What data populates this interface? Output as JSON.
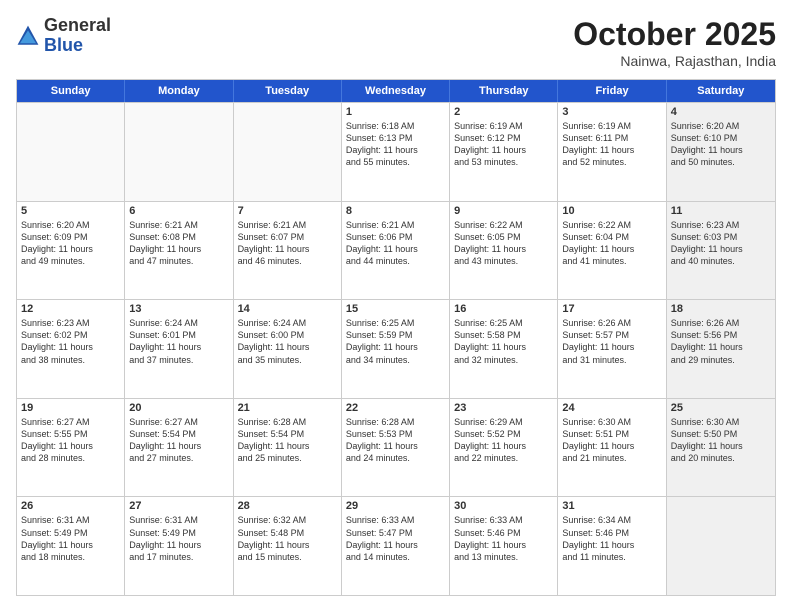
{
  "header": {
    "logo_general": "General",
    "logo_blue": "Blue",
    "month": "October 2025",
    "location": "Nainwa, Rajasthan, India"
  },
  "days_of_week": [
    "Sunday",
    "Monday",
    "Tuesday",
    "Wednesday",
    "Thursday",
    "Friday",
    "Saturday"
  ],
  "rows": [
    [
      {
        "day": "",
        "sunrise": "",
        "sunset": "",
        "daylight": "",
        "shaded": false,
        "empty": true
      },
      {
        "day": "",
        "sunrise": "",
        "sunset": "",
        "daylight": "",
        "shaded": false,
        "empty": true
      },
      {
        "day": "",
        "sunrise": "",
        "sunset": "",
        "daylight": "",
        "shaded": false,
        "empty": true
      },
      {
        "day": "1",
        "sunrise": "Sunrise: 6:18 AM",
        "sunset": "Sunset: 6:13 PM",
        "daylight": "Daylight: 11 hours and 55 minutes.",
        "shaded": false,
        "empty": false
      },
      {
        "day": "2",
        "sunrise": "Sunrise: 6:19 AM",
        "sunset": "Sunset: 6:12 PM",
        "daylight": "Daylight: 11 hours and 53 minutes.",
        "shaded": false,
        "empty": false
      },
      {
        "day": "3",
        "sunrise": "Sunrise: 6:19 AM",
        "sunset": "Sunset: 6:11 PM",
        "daylight": "Daylight: 11 hours and 52 minutes.",
        "shaded": false,
        "empty": false
      },
      {
        "day": "4",
        "sunrise": "Sunrise: 6:20 AM",
        "sunset": "Sunset: 6:10 PM",
        "daylight": "Daylight: 11 hours and 50 minutes.",
        "shaded": true,
        "empty": false
      }
    ],
    [
      {
        "day": "5",
        "sunrise": "Sunrise: 6:20 AM",
        "sunset": "Sunset: 6:09 PM",
        "daylight": "Daylight: 11 hours and 49 minutes.",
        "shaded": false,
        "empty": false
      },
      {
        "day": "6",
        "sunrise": "Sunrise: 6:21 AM",
        "sunset": "Sunset: 6:08 PM",
        "daylight": "Daylight: 11 hours and 47 minutes.",
        "shaded": false,
        "empty": false
      },
      {
        "day": "7",
        "sunrise": "Sunrise: 6:21 AM",
        "sunset": "Sunset: 6:07 PM",
        "daylight": "Daylight: 11 hours and 46 minutes.",
        "shaded": false,
        "empty": false
      },
      {
        "day": "8",
        "sunrise": "Sunrise: 6:21 AM",
        "sunset": "Sunset: 6:06 PM",
        "daylight": "Daylight: 11 hours and 44 minutes.",
        "shaded": false,
        "empty": false
      },
      {
        "day": "9",
        "sunrise": "Sunrise: 6:22 AM",
        "sunset": "Sunset: 6:05 PM",
        "daylight": "Daylight: 11 hours and 43 minutes.",
        "shaded": false,
        "empty": false
      },
      {
        "day": "10",
        "sunrise": "Sunrise: 6:22 AM",
        "sunset": "Sunset: 6:04 PM",
        "daylight": "Daylight: 11 hours and 41 minutes.",
        "shaded": false,
        "empty": false
      },
      {
        "day": "11",
        "sunrise": "Sunrise: 6:23 AM",
        "sunset": "Sunset: 6:03 PM",
        "daylight": "Daylight: 11 hours and 40 minutes.",
        "shaded": true,
        "empty": false
      }
    ],
    [
      {
        "day": "12",
        "sunrise": "Sunrise: 6:23 AM",
        "sunset": "Sunset: 6:02 PM",
        "daylight": "Daylight: 11 hours and 38 minutes.",
        "shaded": false,
        "empty": false
      },
      {
        "day": "13",
        "sunrise": "Sunrise: 6:24 AM",
        "sunset": "Sunset: 6:01 PM",
        "daylight": "Daylight: 11 hours and 37 minutes.",
        "shaded": false,
        "empty": false
      },
      {
        "day": "14",
        "sunrise": "Sunrise: 6:24 AM",
        "sunset": "Sunset: 6:00 PM",
        "daylight": "Daylight: 11 hours and 35 minutes.",
        "shaded": false,
        "empty": false
      },
      {
        "day": "15",
        "sunrise": "Sunrise: 6:25 AM",
        "sunset": "Sunset: 5:59 PM",
        "daylight": "Daylight: 11 hours and 34 minutes.",
        "shaded": false,
        "empty": false
      },
      {
        "day": "16",
        "sunrise": "Sunrise: 6:25 AM",
        "sunset": "Sunset: 5:58 PM",
        "daylight": "Daylight: 11 hours and 32 minutes.",
        "shaded": false,
        "empty": false
      },
      {
        "day": "17",
        "sunrise": "Sunrise: 6:26 AM",
        "sunset": "Sunset: 5:57 PM",
        "daylight": "Daylight: 11 hours and 31 minutes.",
        "shaded": false,
        "empty": false
      },
      {
        "day": "18",
        "sunrise": "Sunrise: 6:26 AM",
        "sunset": "Sunset: 5:56 PM",
        "daylight": "Daylight: 11 hours and 29 minutes.",
        "shaded": true,
        "empty": false
      }
    ],
    [
      {
        "day": "19",
        "sunrise": "Sunrise: 6:27 AM",
        "sunset": "Sunset: 5:55 PM",
        "daylight": "Daylight: 11 hours and 28 minutes.",
        "shaded": false,
        "empty": false
      },
      {
        "day": "20",
        "sunrise": "Sunrise: 6:27 AM",
        "sunset": "Sunset: 5:54 PM",
        "daylight": "Daylight: 11 hours and 27 minutes.",
        "shaded": false,
        "empty": false
      },
      {
        "day": "21",
        "sunrise": "Sunrise: 6:28 AM",
        "sunset": "Sunset: 5:54 PM",
        "daylight": "Daylight: 11 hours and 25 minutes.",
        "shaded": false,
        "empty": false
      },
      {
        "day": "22",
        "sunrise": "Sunrise: 6:28 AM",
        "sunset": "Sunset: 5:53 PM",
        "daylight": "Daylight: 11 hours and 24 minutes.",
        "shaded": false,
        "empty": false
      },
      {
        "day": "23",
        "sunrise": "Sunrise: 6:29 AM",
        "sunset": "Sunset: 5:52 PM",
        "daylight": "Daylight: 11 hours and 22 minutes.",
        "shaded": false,
        "empty": false
      },
      {
        "day": "24",
        "sunrise": "Sunrise: 6:30 AM",
        "sunset": "Sunset: 5:51 PM",
        "daylight": "Daylight: 11 hours and 21 minutes.",
        "shaded": false,
        "empty": false
      },
      {
        "day": "25",
        "sunrise": "Sunrise: 6:30 AM",
        "sunset": "Sunset: 5:50 PM",
        "daylight": "Daylight: 11 hours and 20 minutes.",
        "shaded": true,
        "empty": false
      }
    ],
    [
      {
        "day": "26",
        "sunrise": "Sunrise: 6:31 AM",
        "sunset": "Sunset: 5:49 PM",
        "daylight": "Daylight: 11 hours and 18 minutes.",
        "shaded": false,
        "empty": false
      },
      {
        "day": "27",
        "sunrise": "Sunrise: 6:31 AM",
        "sunset": "Sunset: 5:49 PM",
        "daylight": "Daylight: 11 hours and 17 minutes.",
        "shaded": false,
        "empty": false
      },
      {
        "day": "28",
        "sunrise": "Sunrise: 6:32 AM",
        "sunset": "Sunset: 5:48 PM",
        "daylight": "Daylight: 11 hours and 15 minutes.",
        "shaded": false,
        "empty": false
      },
      {
        "day": "29",
        "sunrise": "Sunrise: 6:33 AM",
        "sunset": "Sunset: 5:47 PM",
        "daylight": "Daylight: 11 hours and 14 minutes.",
        "shaded": false,
        "empty": false
      },
      {
        "day": "30",
        "sunrise": "Sunrise: 6:33 AM",
        "sunset": "Sunset: 5:46 PM",
        "daylight": "Daylight: 11 hours and 13 minutes.",
        "shaded": false,
        "empty": false
      },
      {
        "day": "31",
        "sunrise": "Sunrise: 6:34 AM",
        "sunset": "Sunset: 5:46 PM",
        "daylight": "Daylight: 11 hours and 11 minutes.",
        "shaded": false,
        "empty": false
      },
      {
        "day": "",
        "sunrise": "",
        "sunset": "",
        "daylight": "",
        "shaded": true,
        "empty": true
      }
    ]
  ]
}
